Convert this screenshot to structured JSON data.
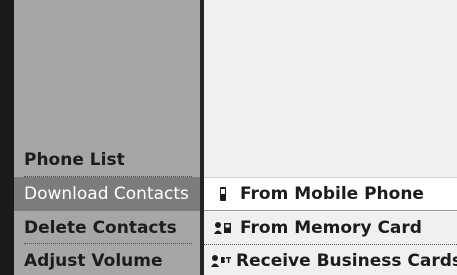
{
  "menu": {
    "items": [
      {
        "label": "Phone List"
      },
      {
        "label": "Download Contacts"
      },
      {
        "label": "Delete Contacts"
      },
      {
        "label": "Adjust Volume"
      }
    ]
  },
  "submenu": {
    "items": [
      {
        "label": "From Mobile Phone",
        "icon": "mobile-phone-icon"
      },
      {
        "label": "From Memory Card",
        "icon": "memory-card-contact-icon"
      },
      {
        "label": "Receive Business Cards",
        "icon": "bluetooth-contact-icon"
      }
    ]
  },
  "colors": {
    "left_panel": "#a6a6a6",
    "selected": "#7c7c7c",
    "right_panel": "#f0f0f0"
  }
}
